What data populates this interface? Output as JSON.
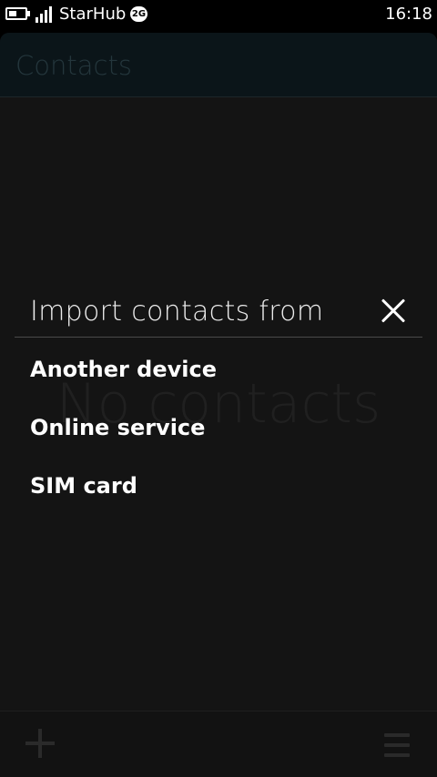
{
  "status_bar": {
    "carrier": "StarHub",
    "network": "2G",
    "time": "16:18",
    "battery_level": 0.5,
    "signal_bars": 4
  },
  "app": {
    "title": "Contacts",
    "empty_text": "No contacts",
    "toolbar": {
      "add_icon": "plus-icon",
      "menu_icon": "menu-icon"
    }
  },
  "dialog": {
    "title": "Import contacts from",
    "close_icon": "close-icon",
    "options": [
      "Another device",
      "Online service",
      "SIM card"
    ]
  },
  "colors": {
    "background": "#141414",
    "header": "#0b1519",
    "text": "#ffffff"
  }
}
